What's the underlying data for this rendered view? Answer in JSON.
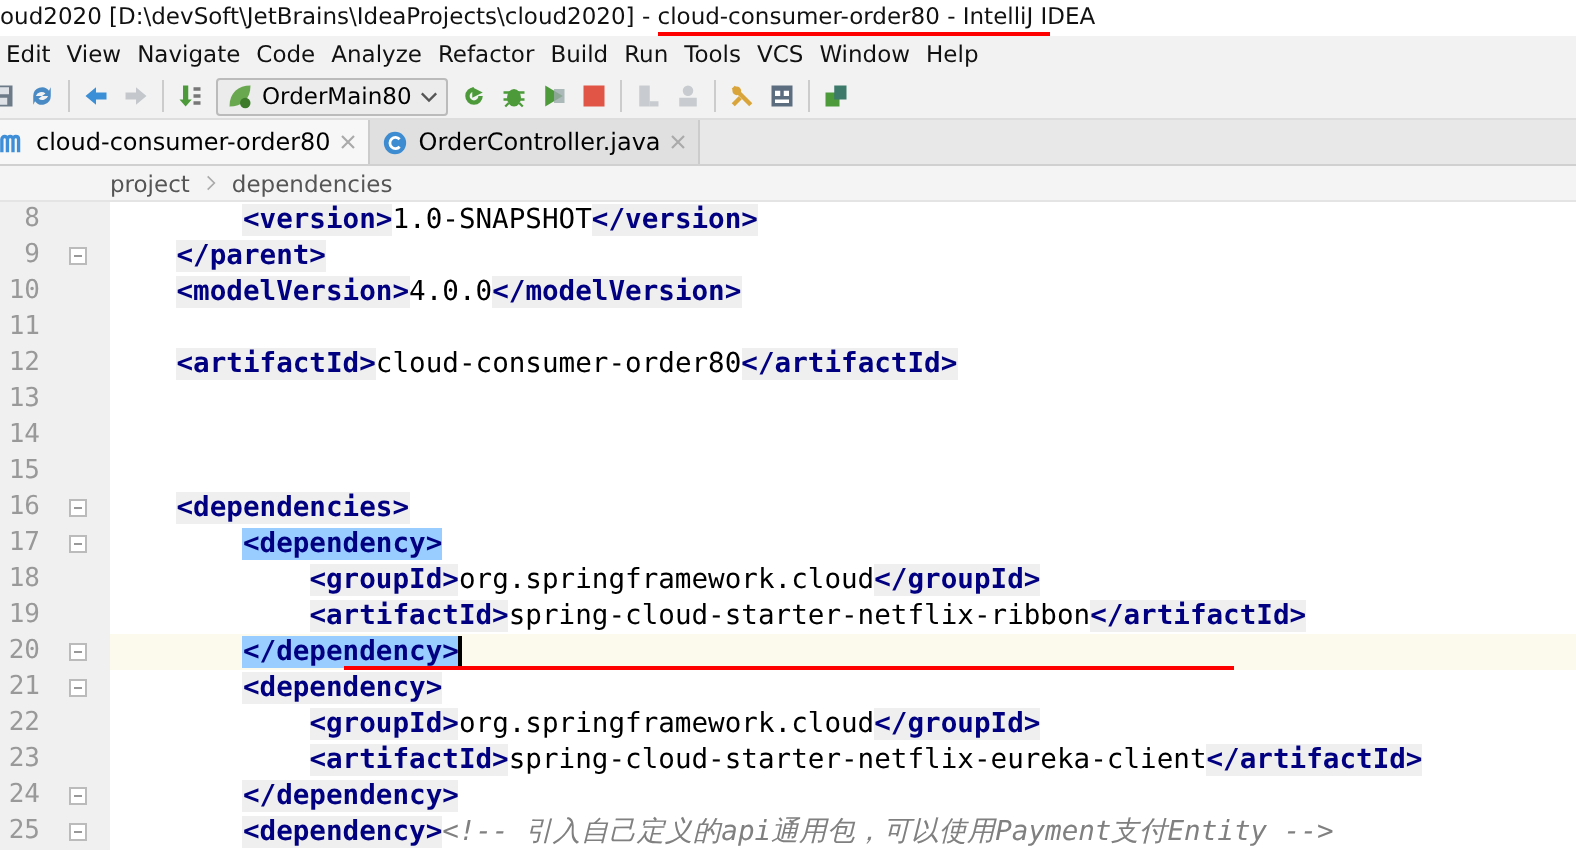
{
  "window": {
    "title_parts": [
      {
        "text": "oud2020 [D:\\devSoft\\JetBrains\\IdeaProjects\\cloud2020] - ",
        "underlined": false
      },
      {
        "text": "cloud-consumer-order80 - IntelliJ",
        "underlined": true
      },
      {
        "text": " IDEA",
        "underlined": false
      }
    ]
  },
  "menu": [
    "Edit",
    "View",
    "Navigate",
    "Code",
    "Analyze",
    "Refactor",
    "Build",
    "Run",
    "Tools",
    "VCS",
    "Window",
    "Help"
  ],
  "toolbar": {
    "run_config": "OrderMain80"
  },
  "tabs": [
    {
      "label": "cloud-consumer-order80",
      "kind": "maven",
      "selected": true
    },
    {
      "label": "OrderController.java",
      "kind": "class",
      "selected": false
    }
  ],
  "breadcrumb": [
    "project",
    "dependencies"
  ],
  "lines": [
    {
      "number": "8",
      "current": false,
      "underlined": false,
      "fold": false,
      "tokens": [
        {
          "kind": "tag",
          "text": "        <version>",
          "matched": false
        },
        {
          "kind": "text",
          "text": "1.0-SNAPSHOT"
        },
        {
          "kind": "tag",
          "text": "</version>",
          "matched": false
        }
      ]
    },
    {
      "number": "9",
      "current": false,
      "underlined": false,
      "fold": true,
      "tokens": [
        {
          "kind": "tag",
          "text": "    </parent>",
          "matched": false
        }
      ]
    },
    {
      "number": "10",
      "current": false,
      "underlined": false,
      "fold": false,
      "tokens": [
        {
          "kind": "tag",
          "text": "    <modelVersion>",
          "matched": false
        },
        {
          "kind": "text",
          "text": "4.0.0"
        },
        {
          "kind": "tag",
          "text": "</modelVersion>",
          "matched": false
        }
      ]
    },
    {
      "number": "11",
      "current": false,
      "underlined": false,
      "fold": false
    },
    {
      "number": "12",
      "current": false,
      "underlined": false,
      "fold": false,
      "tokens": [
        {
          "kind": "tag",
          "text": "    <artifactId>",
          "matched": false
        },
        {
          "kind": "text",
          "text": "cloud-consumer-order80"
        },
        {
          "kind": "tag",
          "text": "</artifactId>",
          "matched": false
        }
      ]
    },
    {
      "number": "13",
      "current": false,
      "underlined": false,
      "fold": false
    },
    {
      "number": "14",
      "current": false,
      "underlined": false,
      "fold": false
    },
    {
      "number": "15",
      "current": false,
      "underlined": false,
      "fold": false
    },
    {
      "number": "16",
      "current": false,
      "underlined": false,
      "fold": true,
      "tokens": [
        {
          "kind": "tag",
          "text": "    <dependencies>",
          "matched": false
        }
      ]
    },
    {
      "number": "17",
      "current": false,
      "underlined": false,
      "fold": true,
      "tokens": [
        {
          "kind": "tag",
          "text": "        <dependency>",
          "matched": true
        }
      ]
    },
    {
      "number": "18",
      "current": false,
      "underlined": false,
      "fold": false,
      "tokens": [
        {
          "kind": "tag",
          "text": "            <groupId>",
          "matched": false
        },
        {
          "kind": "text",
          "text": "org.springframework.cloud"
        },
        {
          "kind": "tag",
          "text": "</groupId>",
          "matched": false
        }
      ]
    },
    {
      "number": "19",
      "current": false,
      "underlined": false,
      "fold": false,
      "tokens": [
        {
          "kind": "tag",
          "text": "            <artifactId>",
          "matched": false
        },
        {
          "kind": "text",
          "text": "spring-cloud-starter-netflix-ribbon"
        },
        {
          "kind": "tag",
          "text": "</artifactId>",
          "matched": false
        }
      ]
    },
    {
      "number": "20",
      "current": true,
      "underlined": true,
      "fold": true,
      "tokens": [
        {
          "kind": "tag",
          "text": "        </dependency>",
          "matched": true
        }
      ]
    },
    {
      "number": "21",
      "current": false,
      "underlined": false,
      "fold": true,
      "tokens": [
        {
          "kind": "tag",
          "text": "        <dependency>",
          "matched": false
        }
      ]
    },
    {
      "number": "22",
      "current": false,
      "underlined": false,
      "fold": false,
      "tokens": [
        {
          "kind": "tag",
          "text": "            <groupId>",
          "matched": false
        },
        {
          "kind": "text",
          "text": "org.springframework.cloud"
        },
        {
          "kind": "tag",
          "text": "</groupId>",
          "matched": false
        }
      ]
    },
    {
      "number": "23",
      "current": false,
      "underlined": false,
      "fold": false,
      "tokens": [
        {
          "kind": "tag",
          "text": "            <artifactId>",
          "matched": false
        },
        {
          "kind": "text",
          "text": "spring-cloud-starter-netflix-eureka-client"
        },
        {
          "kind": "tag",
          "text": "</artifactId>",
          "matched": false
        }
      ]
    },
    {
      "number": "24",
      "current": false,
      "underlined": false,
      "fold": true,
      "tokens": [
        {
          "kind": "tag",
          "text": "        </dependency>",
          "matched": false
        }
      ]
    },
    {
      "number": "25",
      "current": false,
      "underlined": false,
      "fold": true,
      "tokens": [
        {
          "kind": "tag",
          "text": "        <dependency>",
          "matched": false
        },
        {
          "kind": "comment",
          "text": "<!-- 引入自己定义的api通用包，可以使用Payment支付Entity -->"
        }
      ]
    }
  ]
}
